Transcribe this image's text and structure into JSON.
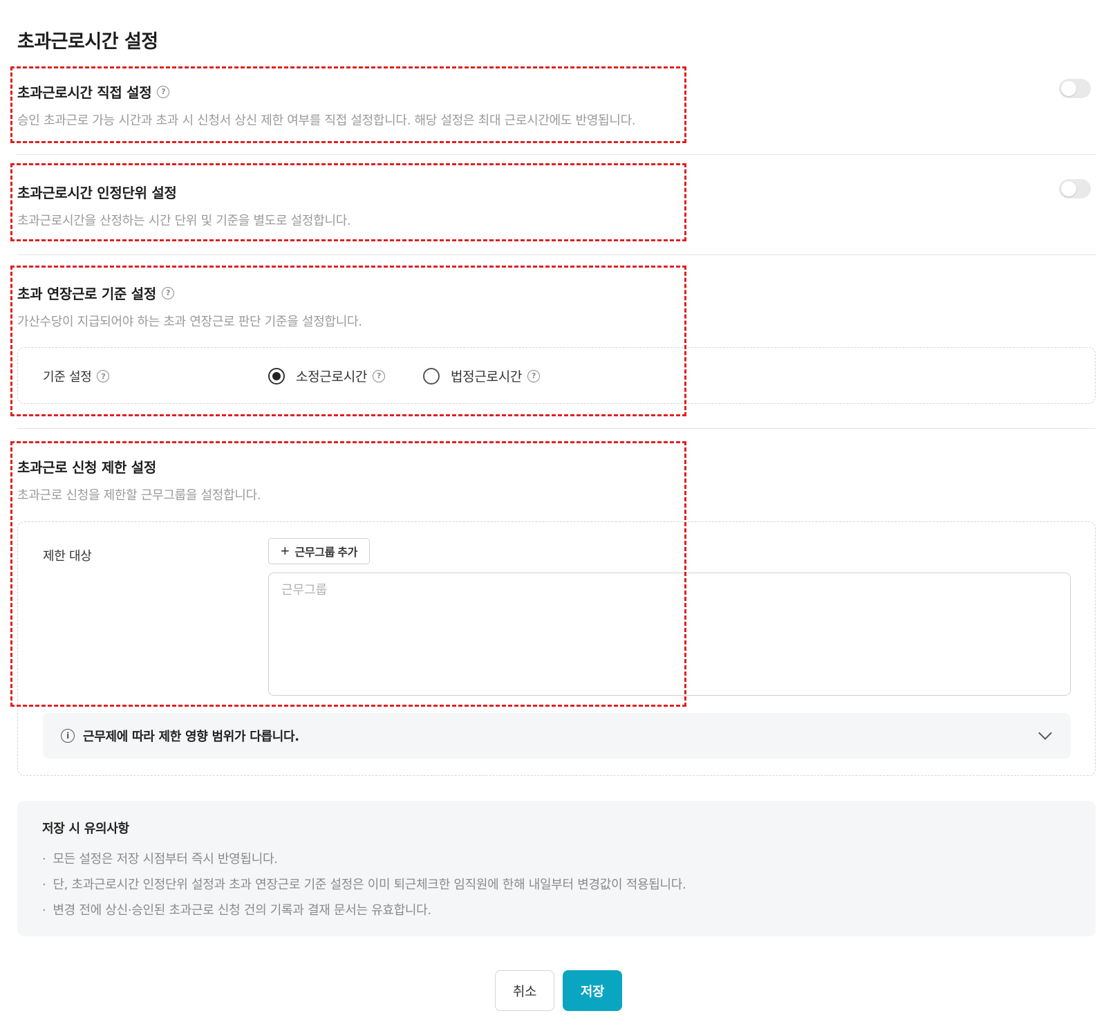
{
  "page": {
    "title": "초과근로시간 설정"
  },
  "sections": {
    "direct": {
      "title": "초과근로시간 직접 설정",
      "desc": "승인 초과근로 가능 시간과 초과 시 신청서 상신 제한 여부를 직접 설정합니다. 해당 설정은 최대 근로시간에도 반영됩니다.",
      "toggle_on": false
    },
    "unit": {
      "title": "초과근로시간 인정단위 설정",
      "desc": "초과근로시간을 산정하는 시간 단위 및 기준을 별도로 설정합니다.",
      "toggle_on": false
    },
    "criteria": {
      "title": "초과 연장근로 기준 설정",
      "desc": "가산수당이 지급되어야 하는 초과 연장근로 판단 기준을 설정합니다.",
      "field_label": "기준 설정",
      "options": [
        {
          "label": "소정근로시간",
          "checked": true
        },
        {
          "label": "법정근로시간",
          "checked": false
        }
      ]
    },
    "restrict": {
      "title": "초과근로 신청 제한 설정",
      "desc": "초과근로 신청을 제한할 근무그룹을 설정합니다.",
      "field_label": "제한 대상",
      "add_button": "근무그룹 추가",
      "placeholder": "근무그룹",
      "info_text": "근무제에 따라 제한 영향 범위가 다릅니다."
    }
  },
  "notice": {
    "title": "저장 시 유의사항",
    "items": [
      "모든 설정은 저장 시점부터 즉시 반영됩니다.",
      "단, 초과근로시간 인정단위 설정과 초과 연장근로 기준 설정은 이미 퇴근체크한 임직원에 한해 내일부터 변경값이 적용됩니다.",
      "변경 전에 상신·승인된 초과근로 신청 건의 기록과 결재 문서는 유효합니다."
    ]
  },
  "footer": {
    "cancel": "취소",
    "save": "저장"
  },
  "colors": {
    "accent": "#0aa5c0",
    "annotation": "#e02020"
  },
  "icons": {
    "help": "question-circle-icon",
    "info": "info-circle-icon",
    "expand": "chevron-down-icon",
    "add": "plus-icon"
  }
}
